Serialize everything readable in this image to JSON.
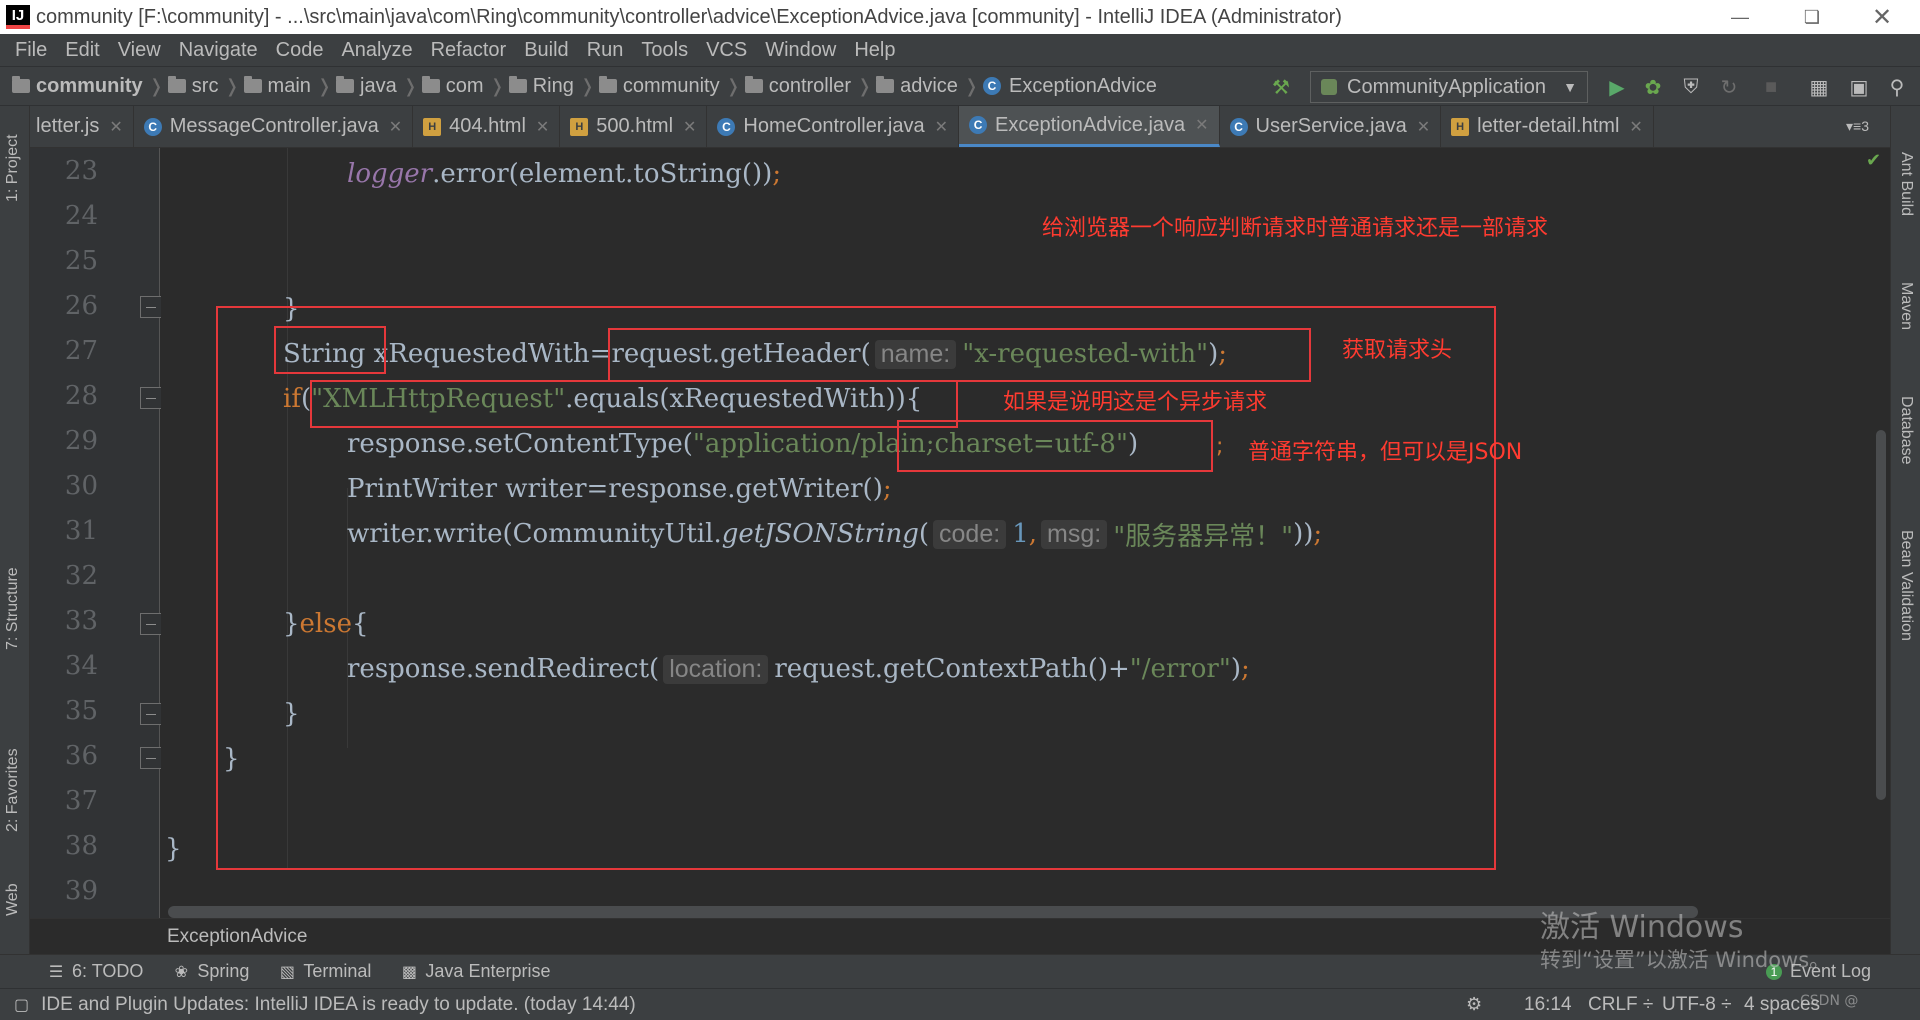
{
  "window": {
    "title": "community [F:\\community] - ...\\src\\main\\java\\com\\Ring\\community\\controller\\advice\\ExceptionAdvice.java [community] - IntelliJ IDEA (Administrator)",
    "app_icon": "IJ"
  },
  "menu": [
    "File",
    "Edit",
    "View",
    "Navigate",
    "Code",
    "Analyze",
    "Refactor",
    "Build",
    "Run",
    "Tools",
    "VCS",
    "Window",
    "Help"
  ],
  "breadcrumbs": [
    "community",
    "src",
    "main",
    "java",
    "com",
    "Ring",
    "community",
    "controller",
    "advice"
  ],
  "breadcrumb_class": "ExceptionAdvice",
  "run_config": "CommunityApplication",
  "tabs": [
    {
      "label": "letter.js",
      "active": false
    },
    {
      "label": "MessageController.java",
      "active": false
    },
    {
      "label": "404.html",
      "active": false
    },
    {
      "label": "500.html",
      "active": false
    },
    {
      "label": "HomeController.java",
      "active": false
    },
    {
      "label": "ExceptionAdvice.java",
      "active": true
    },
    {
      "label": "UserService.java",
      "active": false
    },
    {
      "label": "letter-detail.html",
      "active": false
    }
  ],
  "tabs_more": "3",
  "left_tools": [
    "1: Project",
    "7: Structure",
    "2: Favorites",
    "Web"
  ],
  "right_tools": [
    "Ant Build",
    "Maven",
    "Database",
    "Bean Validation"
  ],
  "code": {
    "line_numbers": [
      "23",
      "24",
      "25",
      "26",
      "27",
      "28",
      "29",
      "30",
      "31",
      "32",
      "33",
      "34",
      "35",
      "36",
      "37",
      "38",
      "39"
    ],
    "l23": {
      "field": "logger",
      "rest": ".error(element.toString())",
      "sc": ";"
    },
    "l26": {
      "text": "}"
    },
    "l27": {
      "type": "String",
      "var": " xRequestedWith=request.getHeader(",
      "hint": "name:",
      "str": "\"x-requested-with\"",
      "close": ")",
      "sc": ";"
    },
    "l28": {
      "kw": "if",
      "open": "(",
      "str": "\"XMLHttpRequest\"",
      "rest": ".equals(xRequestedWith)){"
    },
    "l29": {
      "pre": "response.setContentType(",
      "str": "\"application/plain;charset=utf-8\"",
      "close": ")",
      "sc": ";"
    },
    "l30": {
      "pre": "PrintWriter writer=response.getWriter()",
      "sc": ";"
    },
    "l31": {
      "pre": "writer.write(CommunityUtil.",
      "method": "getJSONString",
      "open": "(",
      "hint1": "code:",
      "num": "1",
      "comma": ",",
      "hint2": "msg:",
      "str": "\"服务器异常！\"",
      "close": "))",
      "sc": ";"
    },
    "l33": {
      "open": "}",
      "kw": "else",
      "brace": "{"
    },
    "l34": {
      "pre": "response.sendRedirect(",
      "hint": "location:",
      "mid": "request.getContextPath()+",
      "str": "\"/error\"",
      "close": ")",
      "sc": ";"
    },
    "l35": {
      "text": "}"
    },
    "l36": {
      "text": "}"
    },
    "l38": {
      "text": "}"
    }
  },
  "annotations": {
    "top_note": "给浏览器一个响应判断请求时普通请求还是一部请求",
    "header_note": "获取请求头",
    "async_note": "如果是说明这是个异步请求",
    "string_note": "普通字符串，但可以是JSON",
    "string_note_sc": ";"
  },
  "file_breadcrumb": "ExceptionAdvice",
  "tool_windows": [
    {
      "label": "6: TODO",
      "icon": "list-icon"
    },
    {
      "label": "Spring",
      "icon": "spring-icon"
    },
    {
      "label": "Terminal",
      "icon": "terminal-icon"
    },
    {
      "label": "Java Enterprise",
      "icon": "java-enterprise-icon"
    }
  ],
  "event_log": {
    "label": "Event Log",
    "count": "1"
  },
  "status": {
    "message": "IDE and Plugin Updates: IntelliJ IDEA is ready to update. (today 14:44)",
    "position": "16:14",
    "line_sep": "CRLF ÷",
    "encoding": "UTF-8 ÷",
    "indent": "4 spaces"
  },
  "watermark": {
    "line1": "激活 Windows",
    "line2": "转到“设置”以激活 Windows。",
    "csdn": "CSDN @"
  },
  "colors": {
    "accent": "#4a88c7",
    "annotation_red": "#e5383b",
    "string": "#6a8759",
    "keyword": "#cc7832"
  }
}
